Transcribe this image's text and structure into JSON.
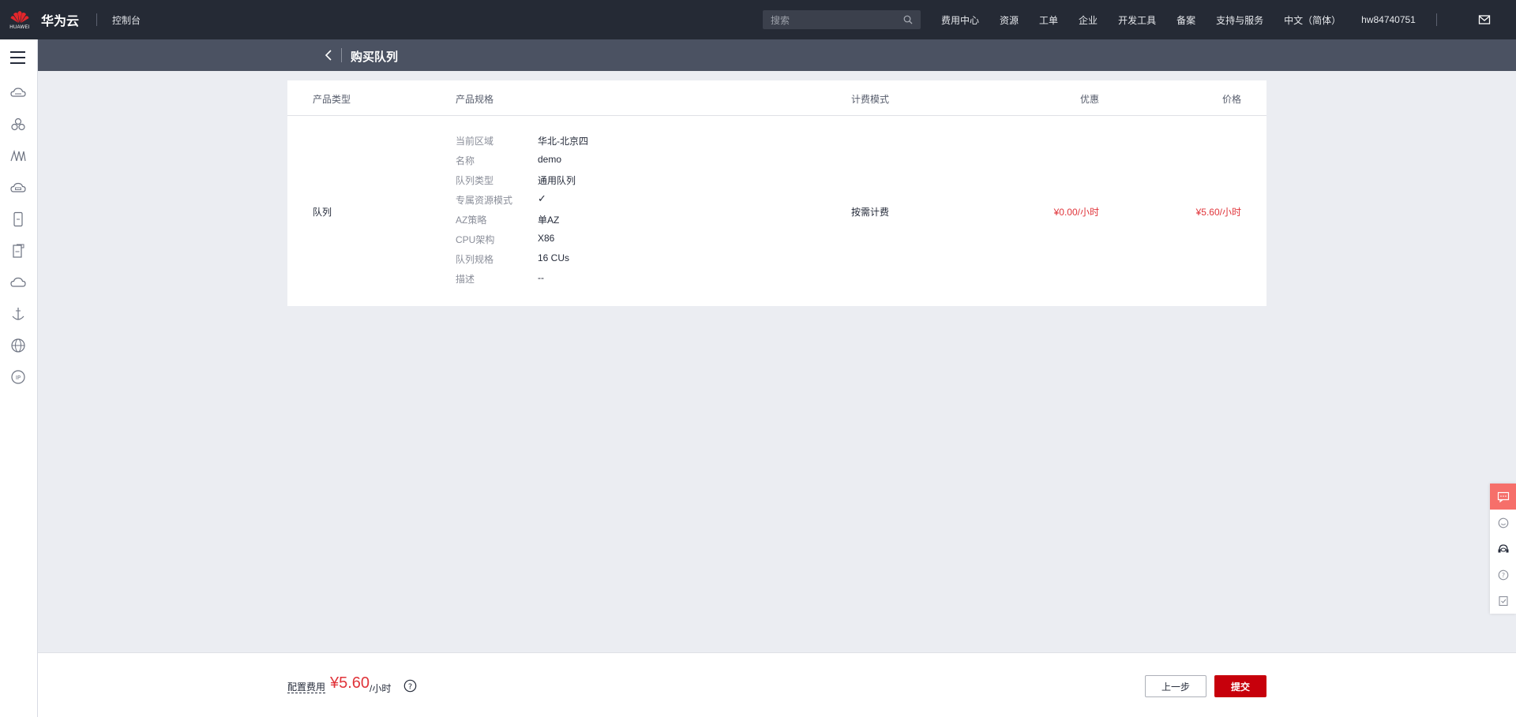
{
  "topbar": {
    "logo_word": "HUAWEI",
    "brand": "华为云",
    "console": "控制台",
    "search_placeholder": "搜索",
    "nav": [
      "费用中心",
      "资源",
      "工单",
      "企业",
      "开发工具",
      "备案",
      "支持与服务",
      "中文（简体）",
      "hw84740751"
    ]
  },
  "sidebar": {
    "icons": [
      "cloud-server-icon",
      "cluster-icon",
      "bridge-icon",
      "cloud-storage-icon",
      "phone-icon",
      "document-icon",
      "cloud-icon",
      "anchor-icon",
      "globe-icon",
      "ip-icon"
    ]
  },
  "page": {
    "title": "购买队列"
  },
  "table": {
    "headers": [
      "产品类型",
      "产品规格",
      "计费模式",
      "优惠",
      "价格"
    ],
    "row": {
      "product_type": "队列",
      "specs": [
        {
          "label": "当前区域",
          "value": "华北-北京四"
        },
        {
          "label": "名称",
          "value": "demo"
        },
        {
          "label": "队列类型",
          "value": "通用队列"
        },
        {
          "label": "专属资源模式",
          "value": "✓"
        },
        {
          "label": "AZ策略",
          "value": "单AZ"
        },
        {
          "label": "CPU架构",
          "value": "X86"
        },
        {
          "label": "队列规格",
          "value": "16 CUs"
        },
        {
          "label": "描述",
          "value": "--"
        }
      ],
      "billing": "按需计费",
      "discount": "¥0.00/小时",
      "price": "¥5.60/小时"
    }
  },
  "footer": {
    "fee_label": "配置费用",
    "fee_amount": "¥5.60",
    "fee_unit": "/小时",
    "prev_label": "上一步",
    "submit_label": "提交"
  },
  "float_tools": [
    "chat-icon",
    "smile-icon",
    "headset-icon",
    "question-icon",
    "checklist-icon"
  ],
  "colors": {
    "accent": "#c7000b",
    "price_red": "#e0343a",
    "topbar": "#252a35",
    "titlebar": "#4b5262"
  }
}
